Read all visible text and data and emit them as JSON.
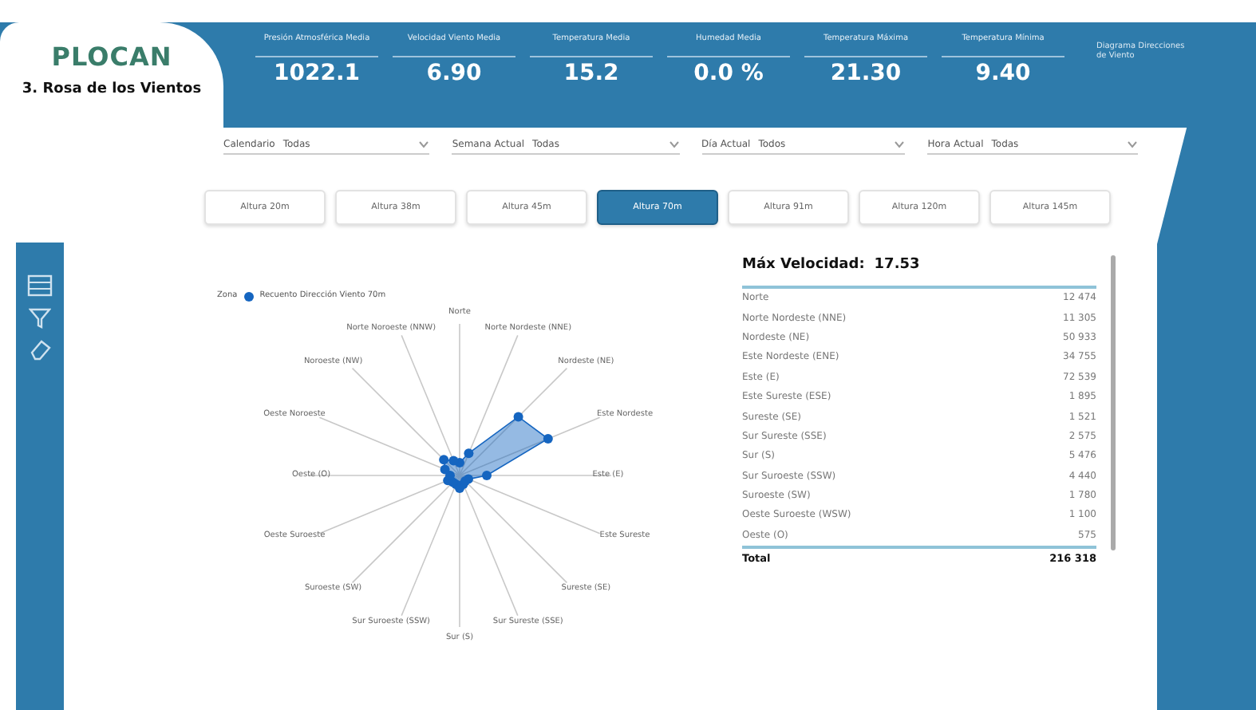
{
  "logo": "PLOCAN",
  "page_title": "3. Rosa de los Vientos",
  "kpis": [
    {
      "label": "Presión Atmosférica Media",
      "value": "1022.1"
    },
    {
      "label": "Velocidad Viento Media",
      "value": "6.90"
    },
    {
      "label": "Temperatura Media",
      "value": "15.2"
    },
    {
      "label": "Humedad Media",
      "value": "0.0 %"
    },
    {
      "label": "Temperatura Máxima",
      "value": "21.30"
    },
    {
      "label": "Temperatura Mínima",
      "value": "9.40"
    }
  ],
  "header_note": "Diagrama Direcciones de Viento",
  "filters": [
    {
      "label": "Calendario",
      "value": "Todas"
    },
    {
      "label": "Semana Actual",
      "value": "Todas"
    },
    {
      "label": "Día Actual",
      "value": "Todos"
    },
    {
      "label": "Hora Actual",
      "value": "Todas"
    }
  ],
  "height_buttons": [
    {
      "label": "Altura 20m",
      "selected": false
    },
    {
      "label": "Altura 38m",
      "selected": false
    },
    {
      "label": "Altura 45m",
      "selected": false
    },
    {
      "label": "Altura 70m",
      "selected": true
    },
    {
      "label": "Altura 91m",
      "selected": false
    },
    {
      "label": "Altura 120m",
      "selected": false
    },
    {
      "label": "Altura 145m",
      "selected": false
    }
  ],
  "radar": {
    "legend_title": "Zona",
    "series": [
      {
        "name": "Recuento Dirección Viento 70m",
        "color": "#1565c0"
      }
    ],
    "axis_labels": [
      "Norte",
      "Norte Noroeste (NNW)",
      "Norte Nordeste (NNE)",
      "Noroeste (NW)",
      "Nordeste (NE)",
      "Oeste Noroeste",
      "Este Nordeste",
      "Oeste (O)",
      "Este (E)",
      "Oeste Suroeste",
      "Este Sureste",
      "Suroeste (SW)",
      "Sureste (SE)",
      "Sur Suroeste (SSW)",
      "Sur Sureste (SSE)",
      "Sur (S)"
    ]
  },
  "table": {
    "title": "Máx Velocidad:",
    "title_value": "17.53",
    "rows": [
      {
        "name": "Norte",
        "value": "12 474"
      },
      {
        "name": "Norte Nordeste (NNE)",
        "value": "11 305"
      },
      {
        "name": "Nordeste (NE)",
        "value": "50 933"
      },
      {
        "name": "Este Nordeste (ENE)",
        "value": "34 755"
      },
      {
        "name": "Este (E)",
        "value": "72 539"
      },
      {
        "name": "Este Sureste (ESE)",
        "value": "1 895"
      },
      {
        "name": "Sureste (SE)",
        "value": "1 521"
      },
      {
        "name": "Sur Sureste (SSE)",
        "value": "2 575"
      },
      {
        "name": "Sur (S)",
        "value": "5 476"
      },
      {
        "name": "Sur Suroeste (SSW)",
        "value": "4 440"
      },
      {
        "name": "Suroeste (SW)",
        "value": "1 780"
      },
      {
        "name": "Oeste Suroeste (WSW)",
        "value": "1 100"
      },
      {
        "name": "Oeste (O)",
        "value": "575"
      }
    ],
    "total_label": "Total",
    "total_value": "216 318"
  }
}
